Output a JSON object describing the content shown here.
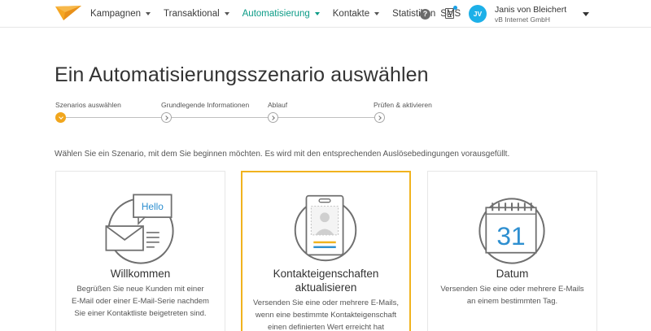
{
  "nav": {
    "items": [
      {
        "label": "Kampagnen",
        "dropdown": true,
        "active": false
      },
      {
        "label": "Transaktional",
        "dropdown": true,
        "active": false
      },
      {
        "label": "Automatisierung",
        "dropdown": true,
        "active": true
      },
      {
        "label": "Kontakte",
        "dropdown": true,
        "active": false
      }
    ],
    "statistiken": "Statistiken",
    "sms": "SMS",
    "help": "?",
    "accent_color": "#0b9b86"
  },
  "user": {
    "initials": "JV",
    "name": "Janis von Bleichert",
    "company": "vB Internet GmbH",
    "avatar_color": "#1db0e8"
  },
  "page": {
    "title": "Ein Automatisierungsszenario auswählen",
    "intro": "Wählen Sie ein Szenario, mit dem Sie beginnen möchten. Es wird mit den entsprechenden Auslösebedingungen vorausgefüllt."
  },
  "steps": [
    {
      "label": "Szenarios auswählen",
      "current": true
    },
    {
      "label": "Grundlegende Informationen",
      "current": false
    },
    {
      "label": "Ablauf",
      "current": false
    },
    {
      "label": "Prüfen & aktivieren",
      "current": false
    }
  ],
  "cards": [
    {
      "icon": "hello-envelope-icon",
      "icon_text": "Hello",
      "title": "Willkommen",
      "description": [
        "Begrüßen Sie neue Kunden mit einer",
        "E-Mail oder einer E-Mail-Serie nachdem",
        "Sie einer Kontaktliste beigetreten sind."
      ],
      "selected": false
    },
    {
      "icon": "contact-card-icon",
      "title_lines": [
        "Kontakteigenschaften",
        "aktualisieren"
      ],
      "description": [
        "Versenden Sie eine oder mehrere E-Mails,",
        "wenn eine bestimmte Kontakteigenschaft",
        "einen definierten Wert erreicht hat"
      ],
      "selected": true
    },
    {
      "icon": "calendar-icon",
      "icon_text": "31",
      "title": "Datum",
      "description": [
        "Versenden Sie eine oder mehrere E-Mails",
        "an einem bestimmten Tag."
      ],
      "selected": false
    }
  ],
  "colors": {
    "selected_border": "#f1b31e",
    "step_current": "#f1a61d",
    "icon_blue": "#2e8fd0",
    "icon_yellow": "#f1b31e"
  }
}
